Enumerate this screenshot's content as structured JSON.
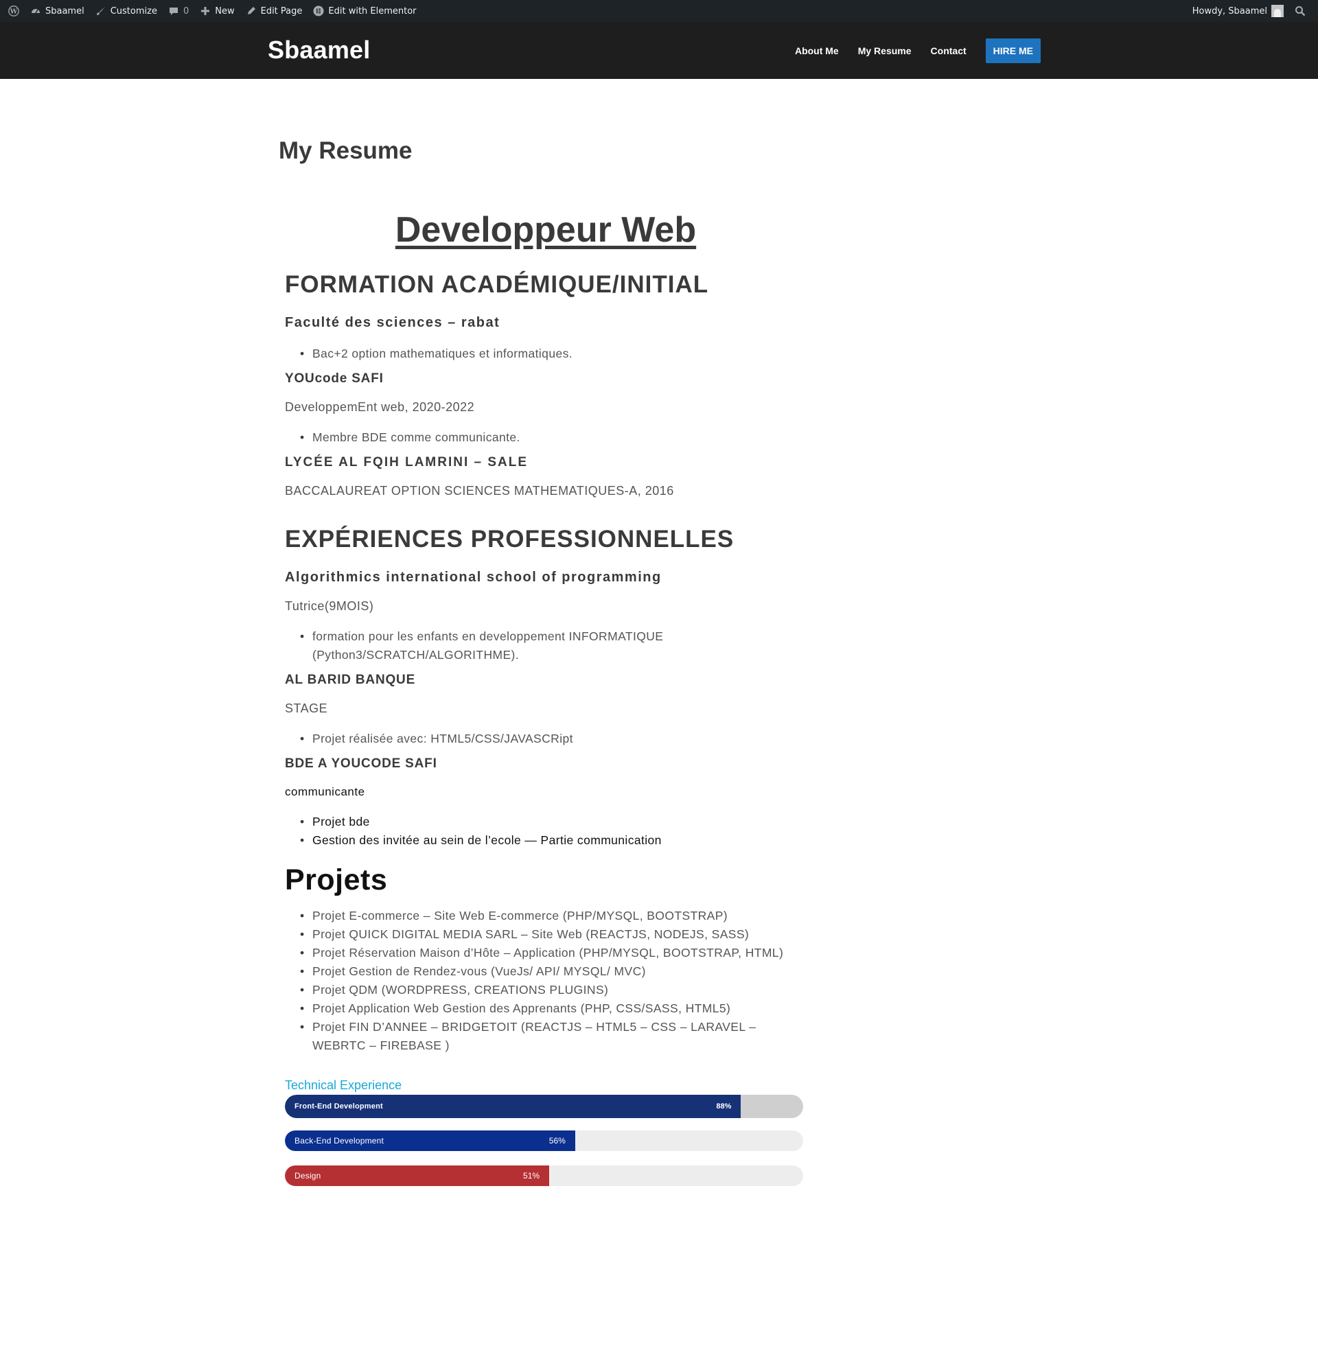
{
  "adminbar": {
    "site_name": "Sbaamel",
    "customize": "Customize",
    "comments_count": "0",
    "new": "New",
    "edit_page": "Edit Page",
    "edit_elementor": "Edit with Elementor",
    "howdy": "Howdy, Sbaamel"
  },
  "header": {
    "site_title": "Sbaamel",
    "nav": [
      "About Me",
      "My Resume",
      "Contact"
    ],
    "cta": "HIRE ME"
  },
  "page": {
    "title": "My Resume",
    "headline": "Developpeur Web",
    "formation": {
      "heading": "FORMATION ACADÉMIQUE/INITIAL",
      "school1": "Faculté des sciences – rabat",
      "school1_item": "Bac+2 option mathematiques et informatiques.",
      "school2": "YOUcode SAFI",
      "school2_desc": "DeveloppemEnt web, 2020-2022",
      "school2_item": "Membre BDE comme communicante.",
      "school3": "LYCÉE AL FQIH LAMRINI – SALE",
      "school3_desc": "BACCALAUREAT OPTION SCIENCES MATHEMATIQUES-A, 2016"
    },
    "experience": {
      "heading": "EXPÉRIENCES PROFESSIONNELLES",
      "job1": "Algorithmics international school of programming",
      "job1_role": "Tutrice(9MOIS)",
      "job1_item": "formation pour les enfants en developpement INFORMATIQUE (Python3/SCRATCH/ALGORITHME).",
      "job2": "AL BARID BANQUE",
      "job2_role": "STAGE",
      "job2_item": "Projet réalisée avec: HTML5/CSS/JAVASCRipt",
      "job3": "BDE A YOUCODE SAFI",
      "job3_role": "communicante",
      "job3_items": [
        "Projet bde",
        "Gestion des invitée au sein de l’ecole — Partie communication"
      ]
    },
    "projets": {
      "heading": "Projets",
      "items": [
        "Projet E-commerce – Site Web E-commerce (PHP/MYSQL, BOOTSTRAP)",
        "Projet QUICK DIGITAL MEDIA SARL – Site Web (REACTJS, NODEJS, SASS)",
        "Projet Réservation Maison d’Hôte – Application (PHP/MYSQL, BOOTSTRAP, HTML)",
        "Projet Gestion de Rendez-vous (VueJs/ API/ MYSQL/ MVC)",
        "Projet QDM (WORDPRESS, CREATIONS PLUGINS)",
        "Projet Application Web Gestion des Apprenants (PHP, CSS/SASS, HTML5)",
        "Projet FIN D’ANNEE – BRIDGETOIT (REACTJS – HTML5 – CSS – LARAVEL – WEBRTC – FIREBASE )"
      ]
    },
    "skills": {
      "title": "Technical Experience",
      "bars": [
        {
          "label": "Front-End Development",
          "percent": 88,
          "percent_text": "88%",
          "color": "#163176"
        },
        {
          "label": "Back-End Development",
          "percent": 56,
          "percent_text": "56%",
          "color": "#0b2f8f"
        },
        {
          "label": "Design",
          "percent": 51,
          "percent_text": "51%",
          "color": "#b53033"
        }
      ]
    }
  },
  "colors": {
    "adminbar": "#1d2327",
    "header": "#1e1e1e",
    "accent": "#1e73be",
    "skills_title": "#16a9d6"
  }
}
